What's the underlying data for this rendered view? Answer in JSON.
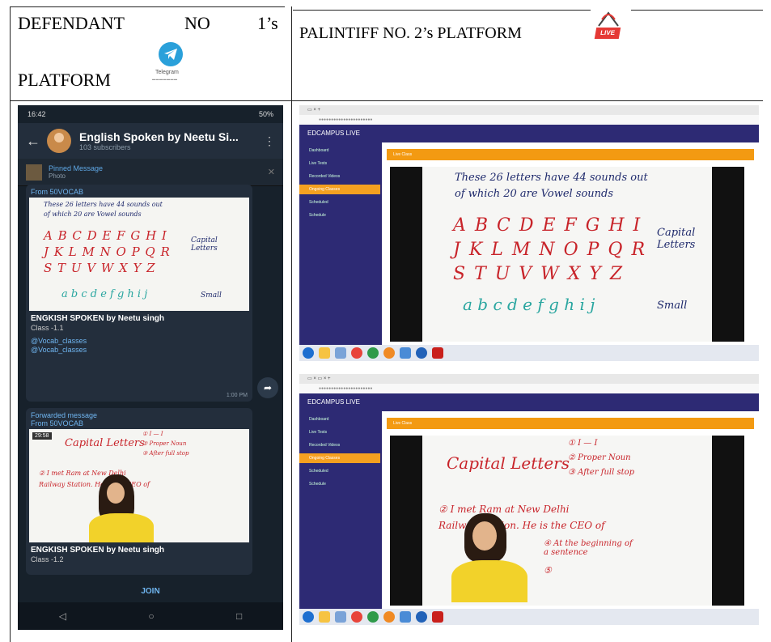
{
  "header": {
    "left_words": [
      "DEFENDANT",
      "NO",
      "1’s",
      "PLATFORM"
    ],
    "right_text": "PALINTIFF NO. 2’s PLATFORM",
    "telegram_logo_text": "Telegram",
    "live_badge": "LIVE"
  },
  "phone": {
    "status_time": "16:42",
    "status_right": "50%",
    "channel_name": "English Spoken by Neetu Si...",
    "subscribers": "103 subscribers",
    "pinned_title": "Pinned Message",
    "pinned_sub": "Photo",
    "msg1": {
      "from": "From 50VOCAB",
      "title": "ENGKISH SPOKEN by Neetu singh",
      "class": "Class -1.1",
      "handles": [
        "@Vocab_classes",
        "@Vocab_classes"
      ],
      "meta": "1:00 PM"
    },
    "msg2": {
      "forwarded": "Forwarded message",
      "from": "From 50VOCAB",
      "time_badge": "29:58",
      "title": "ENGKISH SPOKEN by Neetu singh",
      "class": "Class -1.2"
    },
    "join": "JOIN"
  },
  "board1": {
    "line1": "These 26 letters have 44 sounds out",
    "line2": "of which 20 are Vowel sounds",
    "row1": "A B C D E F G H I",
    "row2": "J K L M N O P Q R",
    "row3": "S T U V W X Y Z",
    "row4": "a b c d e f g h i j",
    "capital": "Capital Letters",
    "small": "Small"
  },
  "board2": {
    "title": "Capital Letters",
    "n1": "① I — I",
    "n2": "② Proper Noun",
    "n3": "③ After full stop",
    "line1": "② I met Ram at New Delhi",
    "line2": "Railway Station. He is the CEO of",
    "n4": "④ At the beginning of a sentence",
    "n5": "⑤"
  },
  "browser": {
    "brand": "EDCAMPUS LIVE",
    "sidebar": [
      "Dashboard",
      "Live Tests",
      "Recorded Videos",
      "Ongoing Classes",
      "Scheduled",
      "Schedule"
    ],
    "bar1": "Live Class",
    "bar2": "Live Class"
  }
}
